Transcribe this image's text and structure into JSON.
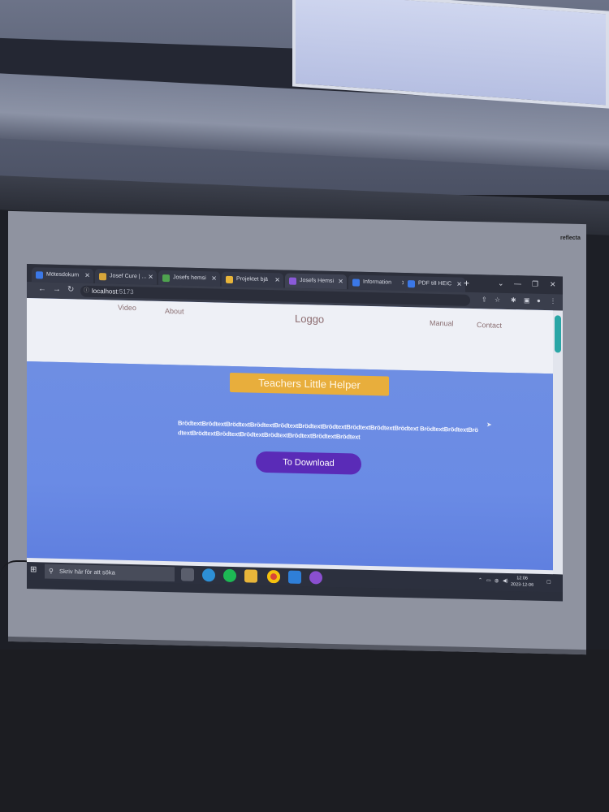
{
  "browser": {
    "tabs": [
      {
        "label": "Mötesdokum",
        "color": "#3b78e7"
      },
      {
        "label": "Josef Cure | ...",
        "color": "#d7a63a"
      },
      {
        "label": "Josefs hemsi",
        "color": "#4fa34f"
      },
      {
        "label": "Projektet bjä",
        "color": "#e8b53a"
      },
      {
        "label": "Josefs Hemsi",
        "color": "#8a5ad8"
      },
      {
        "label": "Information",
        "color": "#3b78e7"
      },
      {
        "label": "PDF till HEIC",
        "color": "#3b78e7"
      }
    ],
    "active_tab_index": 4,
    "new_tab_icon": "+",
    "url_host": "localhost",
    "url_port": ":5173"
  },
  "site": {
    "nav_left": [
      "Video",
      "About"
    ],
    "logo": "Loggo",
    "nav_right": [
      "Manual",
      "Contact"
    ],
    "hero_title": "Teachers Little Helper",
    "body_text": "BrödtextBrödtextBrödtextBrödtextBrödtextBrödtextBrödtextBrödtextBrödtextBrödtext BrödtextBrödtextBrödtextBrödtextBrödtextBrödtextBrödtextBrödtextBrödtextBrödtext",
    "download_button": "To Download"
  },
  "taskbar": {
    "search_placeholder": "Skriv här för att söka",
    "time": "12:06",
    "date": "2023-12-06",
    "apps": [
      {
        "name": "task-view",
        "color": "#5a5e6c"
      },
      {
        "name": "edge",
        "color": "#2d8fd5"
      },
      {
        "name": "spotify",
        "color": "#1db954"
      },
      {
        "name": "file-explorer",
        "color": "#e8b53a"
      },
      {
        "name": "chrome",
        "color": "#db4437"
      },
      {
        "name": "vscode",
        "color": "#2f7fd8"
      },
      {
        "name": "github-desktop",
        "color": "#8a4fd0"
      }
    ]
  },
  "screen_brand": "reflecta"
}
